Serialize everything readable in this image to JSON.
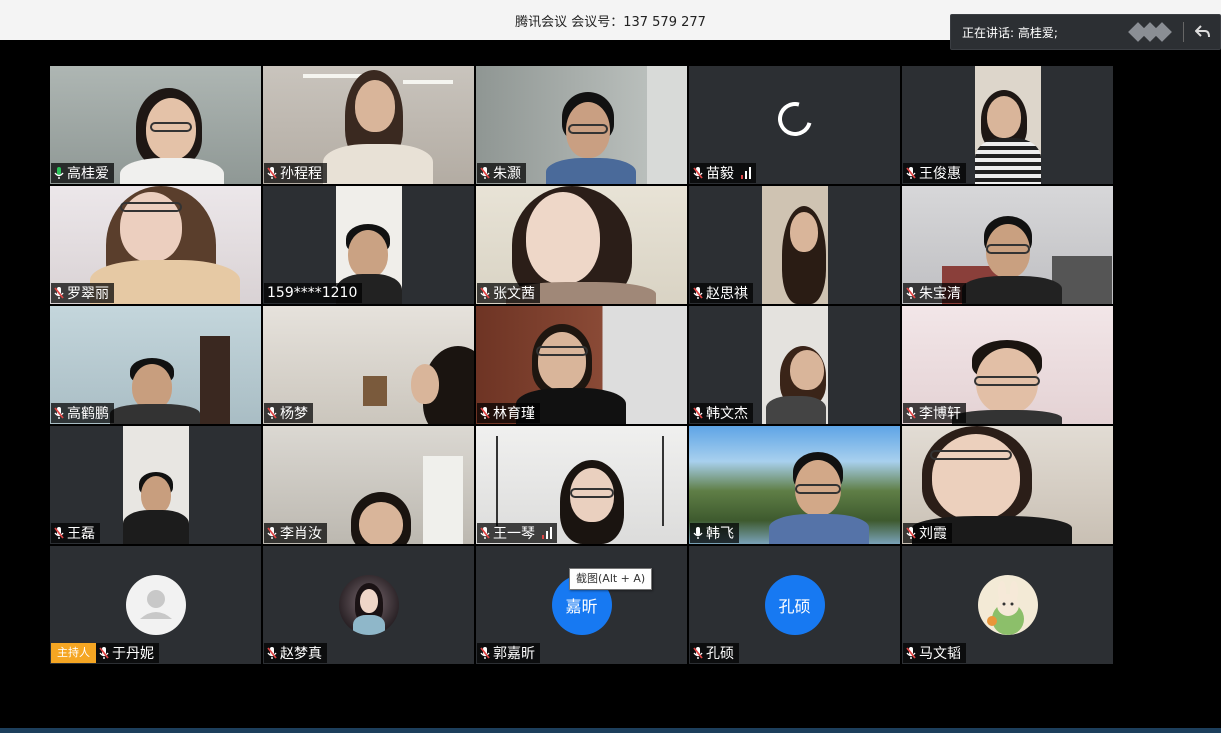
{
  "window": {
    "title": "腾讯会议 会议号：137 579 277"
  },
  "speaking": {
    "label": "正在讲话: 高桂爱;"
  },
  "tooltip": {
    "text": "截图(Alt + A)"
  },
  "host_badge": "主持人",
  "participants": [
    {
      "name": "高桂爱",
      "mic": "active"
    },
    {
      "name": "孙程程",
      "mic": "muted"
    },
    {
      "name": "朱灏",
      "mic": "muted"
    },
    {
      "name": "苗毅",
      "mic": "muted",
      "signal": "weak",
      "video": "loading"
    },
    {
      "name": "王俊惠",
      "mic": "muted"
    },
    {
      "name": "罗翠丽",
      "mic": "muted"
    },
    {
      "name": "159****1210",
      "mic": "none"
    },
    {
      "name": "张文茜",
      "mic": "muted"
    },
    {
      "name": "赵思祺",
      "mic": "muted"
    },
    {
      "name": "朱宝清",
      "mic": "muted"
    },
    {
      "name": "高鹤鹏",
      "mic": "muted"
    },
    {
      "name": "杨梦",
      "mic": "muted"
    },
    {
      "name": "林育瑾",
      "mic": "muted"
    },
    {
      "name": "韩文杰",
      "mic": "muted"
    },
    {
      "name": "李博轩",
      "mic": "muted"
    },
    {
      "name": "王磊",
      "mic": "muted"
    },
    {
      "name": "李肖汝",
      "mic": "muted"
    },
    {
      "name": "王一琴",
      "mic": "muted",
      "signal": "weak"
    },
    {
      "name": "韩飞",
      "mic": "unmuted"
    },
    {
      "name": "刘霞",
      "mic": "muted"
    },
    {
      "name": "于丹妮",
      "mic": "muted",
      "host": true,
      "avatar": "default-user-icon"
    },
    {
      "name": "赵梦真",
      "mic": "muted",
      "avatar": "photo-avatar"
    },
    {
      "name": "郭嘉昕",
      "mic": "muted",
      "avatar_text": "嘉昕"
    },
    {
      "name": "孔硕",
      "mic": "muted",
      "avatar_text": "孔硕"
    },
    {
      "name": "马文韬",
      "mic": "muted",
      "avatar": "cartoon-avatar"
    }
  ],
  "colors": {
    "accent": "#1779f2",
    "host_badge": "#f5a623",
    "mic_active": "#2bc45a",
    "mic_muted": "#e04646"
  }
}
